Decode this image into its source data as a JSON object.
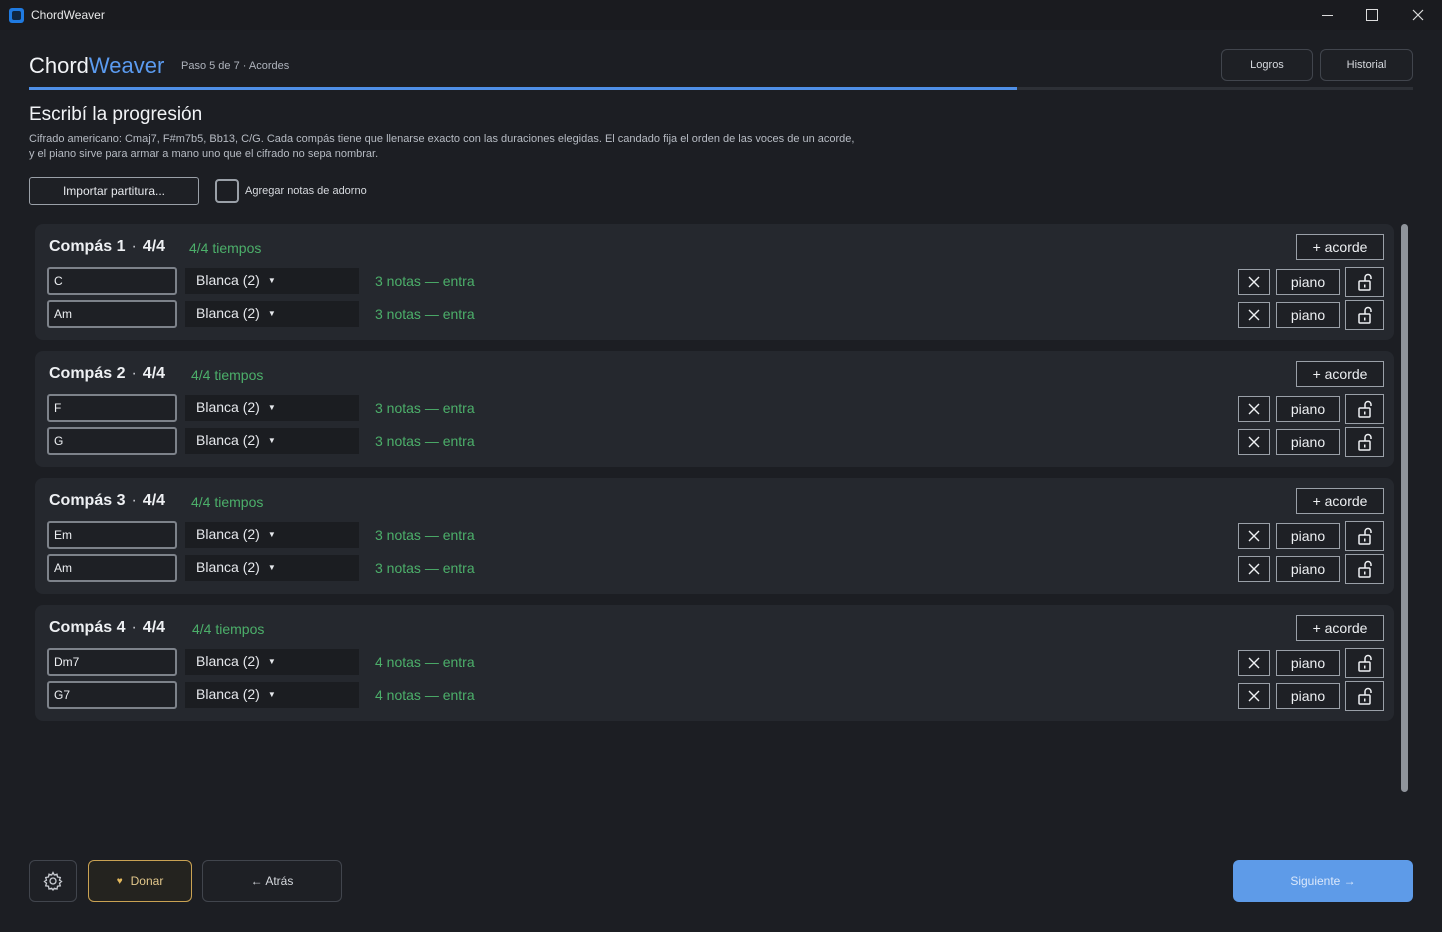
{
  "window": {
    "title": "ChordWeaver",
    "controls": [
      "minimize",
      "maximize",
      "close"
    ]
  },
  "header": {
    "brand_a": "Chord",
    "brand_b": "Weaver",
    "step": "Paso 5 de 7 · Acordes",
    "logros_label": "Logros",
    "historial_label": "Historial",
    "progress": 0.714
  },
  "main": {
    "heading": "Escribí la progresión",
    "description_line1": "Cifrado americano: Cmaj7, F#m7b5, Bb13, C/G. Cada compás tiene que llenarse exacto con las duraciones elegidas. El candado fija el orden de las voces de un acorde,",
    "description_line2": "y el piano sirve para armar a mano uno que el cifrado no sepa nombrar.",
    "import_label": "Importar partitura...",
    "ornament_label": "Agregar notas de adorno",
    "ornament_checked": false
  },
  "measures": [
    {
      "title": "Compás 1",
      "meter": "4/4",
      "beats": "4/4 tiempos",
      "add_label": "+ acorde",
      "chords": [
        {
          "symbol": "C",
          "duration": "Blanca (2)",
          "status": "3 notas — entra",
          "piano": "piano"
        },
        {
          "symbol": "Am",
          "duration": "Blanca (2)",
          "status": "3 notas — entra",
          "piano": "piano"
        }
      ]
    },
    {
      "title": "Compás 2",
      "meter": "4/4",
      "beats": "4/4 tiempos",
      "add_label": "+ acorde",
      "chords": [
        {
          "symbol": "F",
          "duration": "Blanca (2)",
          "status": "3 notas — entra",
          "piano": "piano"
        },
        {
          "symbol": "G",
          "duration": "Blanca (2)",
          "status": "3 notas — entra",
          "piano": "piano"
        }
      ]
    },
    {
      "title": "Compás 3",
      "meter": "4/4",
      "beats": "4/4 tiempos",
      "add_label": "+ acorde",
      "chords": [
        {
          "symbol": "Em",
          "duration": "Blanca (2)",
          "status": "3 notas — entra",
          "piano": "piano"
        },
        {
          "symbol": "Am",
          "duration": "Blanca (2)",
          "status": "3 notas — entra",
          "piano": "piano"
        }
      ]
    },
    {
      "title": "Compás 4",
      "meter": "4/4",
      "beats": "4/4 tiempos",
      "add_label": "+ acorde",
      "chords": [
        {
          "symbol": "Dm7",
          "duration": "Blanca (2)",
          "status": "4 notas — entra",
          "piano": "piano"
        },
        {
          "symbol": "G7",
          "duration": "Blanca (2)",
          "status": "4 notas — entra",
          "piano": "piano"
        }
      ]
    }
  ],
  "footer": {
    "donate_label": "Donar",
    "back_label": "← Atrás",
    "next_label": "Siguiente →"
  },
  "colors": {
    "accent": "#5b9bf0",
    "ok": "#4caf6a",
    "donate": "#c9a253"
  }
}
